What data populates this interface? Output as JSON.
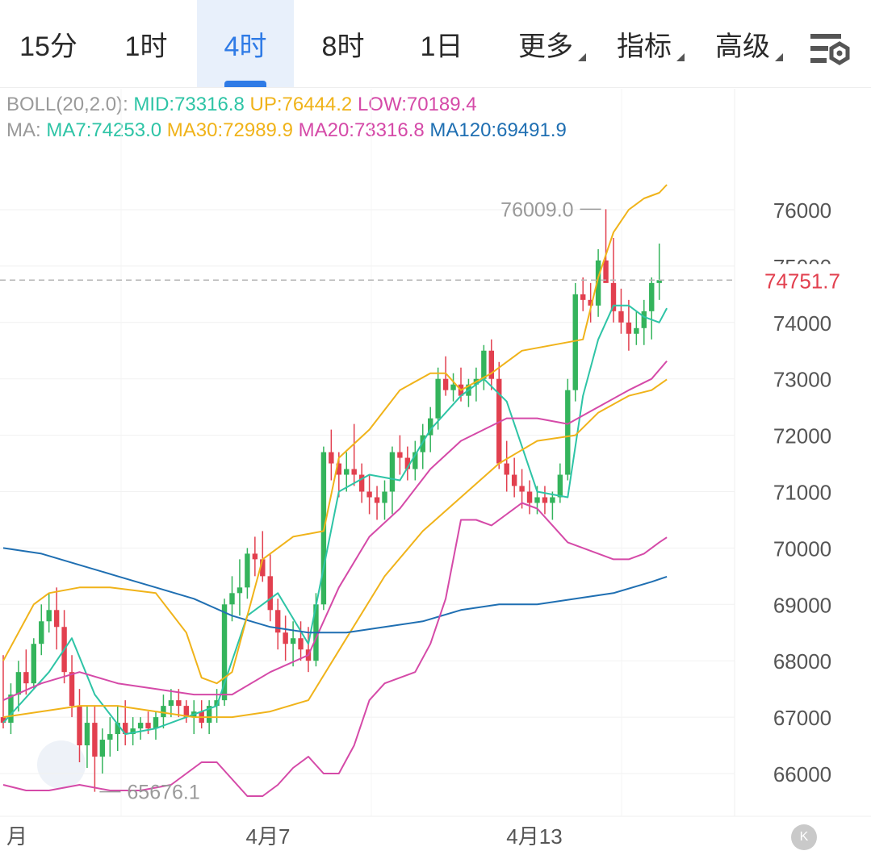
{
  "tabs": [
    {
      "label": "15分",
      "active": false,
      "has_menu": false
    },
    {
      "label": "1时",
      "active": false,
      "has_menu": false
    },
    {
      "label": "4时",
      "active": true,
      "has_menu": false
    },
    {
      "label": "8时",
      "active": false,
      "has_menu": false
    },
    {
      "label": "1日",
      "active": false,
      "has_menu": false
    },
    {
      "label": "更多",
      "active": false,
      "has_menu": true
    },
    {
      "label": "指标",
      "active": false,
      "has_menu": true
    },
    {
      "label": "高级",
      "active": false,
      "has_menu": true
    }
  ],
  "settings_icon": "chart-settings-icon",
  "boll": {
    "label": "BOLL(20,2.0):",
    "mid": "MID:73316.8",
    "up": "UP:76444.2",
    "low": "LOW:70189.4"
  },
  "ma": {
    "label": "MA:",
    "ma7": "MA7:74253.0",
    "ma30": "MA30:72989.9",
    "ma20": "MA20:73316.8",
    "ma120": "MA120:69491.9"
  },
  "colors": {
    "up_candle": "#34b45c",
    "down_candle": "#e2404f",
    "ma7": "#2ec4a6",
    "ma30_upper": "#f0b31a",
    "ma20_lower": "#d54aa8",
    "ma120": "#1f6fb2",
    "last_price": "#e2404f",
    "active_tab": "#2f7be6"
  },
  "chart_data": {
    "type": "candlestick",
    "interval": "4时",
    "y_ticks": [
      76000,
      75000,
      74000,
      73000,
      72000,
      71000,
      70000,
      69000,
      68000,
      67000,
      66000
    ],
    "y_tick_labels": [
      "76000",
      "75000",
      "74000",
      "73000",
      "72000",
      "71000",
      "70000",
      "69000",
      "68000",
      "67000",
      "66000"
    ],
    "ylim": [
      65300,
      76800
    ],
    "x_labels": [
      "月",
      "4月7",
      "4月13"
    ],
    "last_price": 74751.7,
    "last_price_label": "74751.7",
    "high_label": "76009.0",
    "low_label": "65676.1",
    "candles": [
      [
        67000,
        68100,
        66800,
        66900
      ],
      [
        66900,
        67600,
        66700,
        67400
      ],
      [
        67400,
        68000,
        67100,
        67800
      ],
      [
        67800,
        68200,
        67400,
        67600
      ],
      [
        67600,
        68400,
        67500,
        68300
      ],
      [
        68300,
        69000,
        68100,
        68700
      ],
      [
        68700,
        69200,
        68500,
        68900
      ],
      [
        68900,
        69300,
        68200,
        68600
      ],
      [
        68600,
        68900,
        67600,
        67800
      ],
      [
        67800,
        68100,
        67000,
        67200
      ],
      [
        67200,
        67500,
        66200,
        66500
      ],
      [
        66500,
        67200,
        66100,
        66900
      ],
      [
        66900,
        67200,
        65676,
        66300
      ],
      [
        66300,
        66800,
        66000,
        66600
      ],
      [
        66600,
        67000,
        66300,
        66700
      ],
      [
        66700,
        67200,
        66400,
        66900
      ],
      [
        66900,
        67300,
        66500,
        66700
      ],
      [
        66700,
        67000,
        66500,
        66800
      ],
      [
        66800,
        67000,
        66600,
        66900
      ],
      [
        66900,
        67100,
        66700,
        66800
      ],
      [
        66800,
        67100,
        66600,
        67000
      ],
      [
        67000,
        67400,
        66800,
        67200
      ],
      [
        67200,
        67500,
        67000,
        67300
      ],
      [
        67300,
        67500,
        67000,
        67200
      ],
      [
        67200,
        67300,
        66900,
        67000
      ],
      [
        67000,
        67300,
        66700,
        67100
      ],
      [
        67100,
        67300,
        66800,
        66900
      ],
      [
        66900,
        67300,
        66700,
        67200
      ],
      [
        67200,
        67500,
        66900,
        67300
      ],
      [
        67300,
        69100,
        67200,
        69000
      ],
      [
        69000,
        69500,
        68700,
        69200
      ],
      [
        69200,
        69800,
        68800,
        69300
      ],
      [
        69300,
        70000,
        69100,
        69900
      ],
      [
        69900,
        70200,
        69500,
        69800
      ],
      [
        69800,
        70300,
        69400,
        69500
      ],
      [
        69500,
        69900,
        68700,
        68900
      ],
      [
        68900,
        69100,
        68200,
        68500
      ],
      [
        68500,
        68800,
        68000,
        68300
      ],
      [
        68300,
        68700,
        67900,
        68400
      ],
      [
        68400,
        68700,
        68000,
        68200
      ],
      [
        68200,
        68600,
        67800,
        68000
      ],
      [
        68000,
        69200,
        67900,
        69000
      ],
      [
        69000,
        71800,
        68900,
        71700
      ],
      [
        71700,
        72100,
        71200,
        71500
      ],
      [
        71500,
        71700,
        70900,
        71300
      ],
      [
        71300,
        71700,
        71000,
        71400
      ],
      [
        71400,
        72200,
        71100,
        71300
      ],
      [
        71300,
        71500,
        70800,
        71000
      ],
      [
        71000,
        71300,
        70600,
        70900
      ],
      [
        70900,
        71100,
        70500,
        70800
      ],
      [
        70800,
        71200,
        70500,
        71000
      ],
      [
        71000,
        71800,
        70600,
        71700
      ],
      [
        71700,
        72000,
        71300,
        71600
      ],
      [
        71600,
        71800,
        71200,
        71400
      ],
      [
        71400,
        71900,
        71200,
        71700
      ],
      [
        71700,
        72200,
        71400,
        72000
      ],
      [
        72000,
        72500,
        71700,
        72300
      ],
      [
        72300,
        73200,
        72100,
        73000
      ],
      [
        73000,
        73400,
        72700,
        72800
      ],
      [
        72800,
        73100,
        72600,
        72900
      ],
      [
        72900,
        73200,
        72600,
        72700
      ],
      [
        72700,
        73000,
        72500,
        72900
      ],
      [
        72900,
        73200,
        72600,
        73000
      ],
      [
        73000,
        73600,
        72800,
        73500
      ],
      [
        73500,
        73700,
        72800,
        73000
      ],
      [
        73000,
        73300,
        71400,
        71500
      ],
      [
        71500,
        71900,
        71000,
        71300
      ],
      [
        71300,
        71600,
        70900,
        71100
      ],
      [
        71100,
        71400,
        70700,
        71000
      ],
      [
        71000,
        71200,
        70600,
        70800
      ],
      [
        70800,
        71100,
        70600,
        70900
      ],
      [
        70900,
        71100,
        70600,
        70800
      ],
      [
        70800,
        71000,
        70500,
        70900
      ],
      [
        70900,
        71500,
        70800,
        71300
      ],
      [
        71300,
        73000,
        71200,
        72800
      ],
      [
        72800,
        74700,
        72600,
        74500
      ],
      [
        74500,
        74800,
        74200,
        74400
      ],
      [
        74400,
        74700,
        74000,
        74300
      ],
      [
        74300,
        75300,
        74100,
        75100
      ],
      [
        75100,
        76009,
        74800,
        74700
      ],
      [
        74700,
        75500,
        74000,
        74200
      ],
      [
        74200,
        74600,
        73800,
        74000
      ],
      [
        74000,
        74400,
        73500,
        73800
      ],
      [
        73800,
        74200,
        73600,
        73900
      ],
      [
        73900,
        74400,
        73600,
        74200
      ],
      [
        74200,
        74800,
        73700,
        74700
      ],
      [
        74700,
        75400,
        74400,
        74751.7
      ]
    ],
    "series": [
      {
        "name": "MA7",
        "color": "#2ec4a6",
        "x": [
          0,
          6,
          9,
          12,
          16,
          20,
          24,
          28,
          32,
          36,
          40,
          44,
          48,
          52,
          56,
          60,
          63,
          66,
          70,
          74,
          76,
          78,
          80,
          82,
          84,
          86,
          87
        ],
        "values": [
          66900,
          67800,
          68400,
          67400,
          66700,
          66800,
          67000,
          67200,
          68800,
          69200,
          68300,
          71000,
          71300,
          71200,
          72100,
          72700,
          73000,
          72600,
          71000,
          70900,
          72700,
          73700,
          74300,
          74300,
          74100,
          74000,
          74253
        ]
      },
      {
        "name": "MA20",
        "color": "#d54aa8",
        "x": [
          0,
          5,
          10,
          15,
          20,
          25,
          30,
          35,
          40,
          44,
          48,
          52,
          56,
          60,
          63,
          66,
          70,
          74,
          78,
          82,
          85,
          87
        ],
        "values": [
          67300,
          67600,
          67800,
          67600,
          67500,
          67400,
          67400,
          67800,
          68100,
          69300,
          70200,
          70700,
          71400,
          71900,
          72100,
          72300,
          72300,
          72200,
          72500,
          72800,
          73000,
          73316.8
        ]
      },
      {
        "name": "MA30",
        "color": "#f0b31a",
        "x": [
          0,
          5,
          10,
          15,
          20,
          25,
          30,
          35,
          40,
          45,
          50,
          55,
          60,
          65,
          70,
          75,
          78,
          82,
          85,
          87
        ],
        "values": [
          67000,
          67100,
          67200,
          67200,
          67100,
          67000,
          67000,
          67100,
          67300,
          68400,
          69500,
          70300,
          70900,
          71500,
          71900,
          72000,
          72400,
          72700,
          72800,
          72989.9
        ]
      },
      {
        "name": "MA120",
        "color": "#1f6fb2",
        "x": [
          0,
          5,
          10,
          15,
          20,
          25,
          30,
          35,
          40,
          45,
          50,
          55,
          60,
          65,
          70,
          75,
          80,
          85,
          87
        ],
        "values": [
          70000,
          69900,
          69700,
          69500,
          69300,
          69100,
          68800,
          68600,
          68500,
          68500,
          68600,
          68700,
          68900,
          69000,
          69000,
          69100,
          69200,
          69400,
          69491.9
        ]
      },
      {
        "name": "BOLL UP",
        "color": "#f0b31a",
        "x": [
          0,
          4,
          6,
          10,
          14,
          20,
          24,
          26,
          28,
          30,
          34,
          38,
          42,
          44,
          48,
          52,
          56,
          58,
          60,
          64,
          68,
          72,
          76,
          78,
          80,
          82,
          84,
          86,
          87
        ],
        "values": [
          68000,
          69000,
          69200,
          69300,
          69300,
          69200,
          68500,
          67700,
          67600,
          67800,
          69800,
          70200,
          70300,
          71600,
          72100,
          72800,
          73100,
          73100,
          72800,
          73100,
          73500,
          73600,
          73700,
          74800,
          75600,
          76000,
          76200,
          76300,
          76444.2
        ]
      },
      {
        "name": "BOLL LOW",
        "color": "#d54aa8",
        "x": [
          0,
          3,
          6,
          10,
          14,
          18,
          22,
          24,
          26,
          28,
          30,
          32,
          34,
          36,
          38,
          40,
          42,
          44,
          46,
          48,
          50,
          52,
          54,
          56,
          58,
          60,
          62,
          64,
          66,
          68,
          70,
          72,
          74,
          76,
          78,
          80,
          82,
          84,
          86,
          87
        ],
        "values": [
          65800,
          65700,
          65700,
          65800,
          65700,
          65700,
          65800,
          66000,
          66200,
          66200,
          65900,
          65600,
          65600,
          65800,
          66100,
          66300,
          66000,
          66000,
          66500,
          67300,
          67600,
          67700,
          67800,
          68300,
          69100,
          70500,
          70500,
          70400,
          70600,
          70800,
          70700,
          70400,
          70100,
          70000,
          69900,
          69800,
          69800,
          69900,
          70100,
          70189.4
        ]
      }
    ]
  }
}
